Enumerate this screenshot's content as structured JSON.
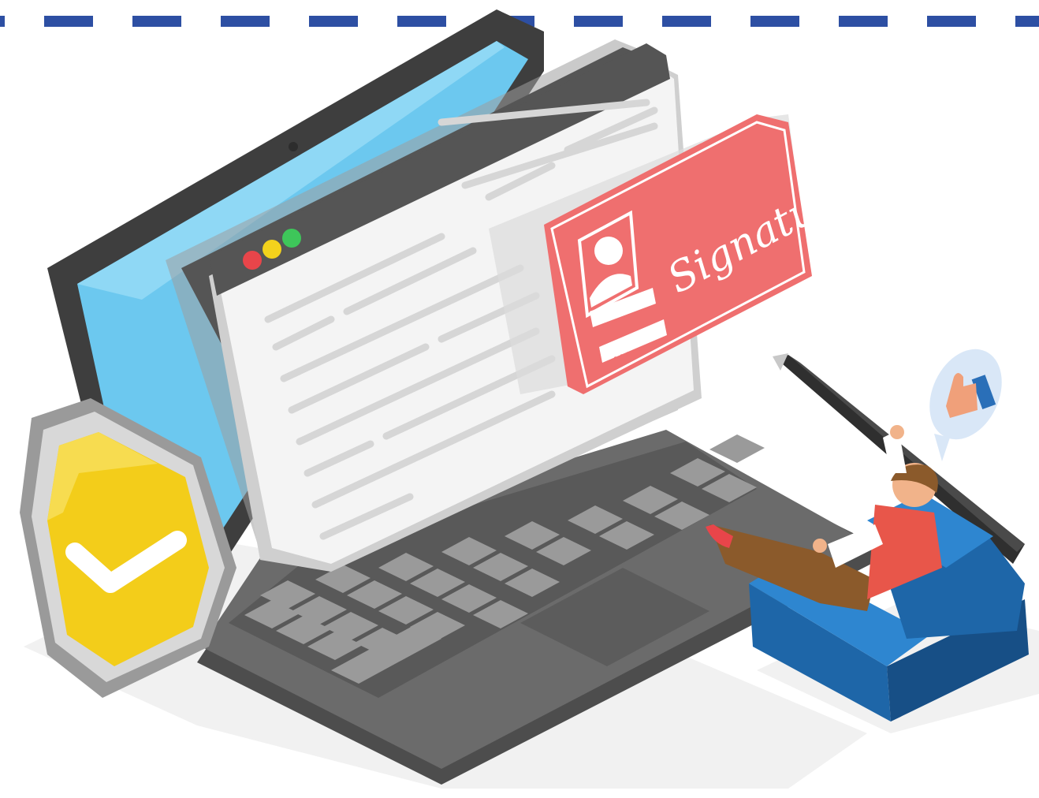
{
  "illustration": {
    "signature_card": {
      "label": "Signature",
      "field_1": "•••••",
      "field_2": "•••••"
    },
    "browser_window": {
      "dots": [
        "red",
        "yellow",
        "green"
      ]
    },
    "icons": [
      "laptop-icon",
      "shield-check-icon",
      "signature-card-icon",
      "pen-icon",
      "thumbs-up-icon",
      "user-icon",
      "armchair-icon"
    ]
  },
  "colors": {
    "border_dash": "#2d4fa3",
    "card_red": "#ef6f6f",
    "shield_yellow": "#f3cd1a",
    "chair_blue": "#2072b8",
    "laptop_gray": "#6b6b6b",
    "screen_blue": "#6cc8ef",
    "dot_red": "#e8454a",
    "dot_yellow": "#f3d21c",
    "dot_green": "#3ec65a"
  }
}
